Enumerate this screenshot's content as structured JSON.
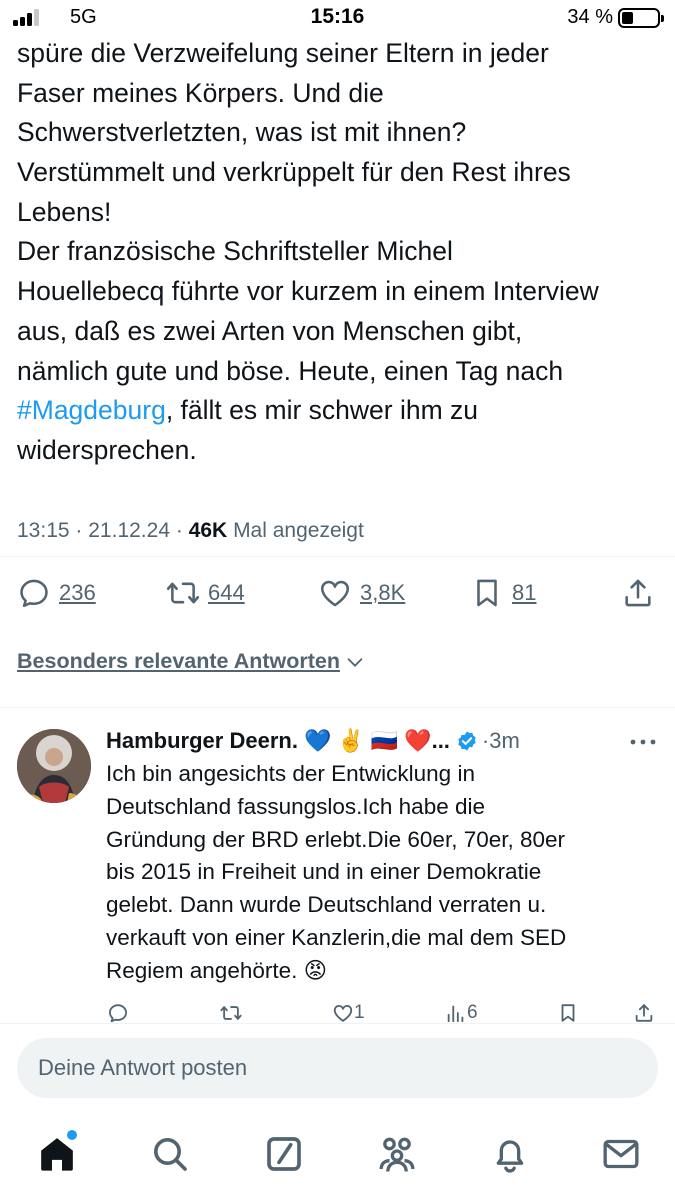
{
  "status_bar": {
    "network": "5G",
    "time": "15:16",
    "battery_percent": "34 %",
    "battery_level": 0.34
  },
  "tweet": {
    "text_lines": [
      "spüre die Verzweifelung seiner Eltern in jeder",
      "Faser meines Körpers. Und die",
      "Schwerstverletzten, was ist mit ihnen?",
      "Verstümmelt und verkrüppelt für den Rest ihres",
      "Lebens!",
      "Der französische Schriftsteller Michel",
      "Houellebecq führte vor kurzem in einem Interview",
      "aus, daß es zwei Arten von Menschen gibt,",
      "nämlich gute und böse. Heute, einen Tag nach"
    ],
    "hashtag": "#Magdeburg",
    "hashtag_line_rest": ", fällt es mir schwer ihm zu",
    "last_line": "widersprechen.",
    "time": "13:15",
    "date": "21.12.24",
    "separator": "·",
    "views": "46K",
    "views_label": "Mal angezeigt",
    "replies": "236",
    "reposts": "644",
    "likes": "3,8K",
    "bookmarks": "81"
  },
  "sort_label": "Besonders relevante Antworten",
  "reply": {
    "name": "Hamburger Deern.",
    "emojis": [
      "💙",
      "✌️",
      "🇷🇺",
      "❤️"
    ],
    "ellipsis": "...",
    "time": "·3m",
    "text_lines": [
      "Ich bin angesichts der Entwicklung in",
      "Deutschland fassungslos.Ich habe die",
      "Gründung der BRD erlebt.Die 60er, 70er, 80er",
      "bis 2015  in Freiheit und in einer Demokratie",
      "gelebt. Dann wurde Deutschland verraten u.",
      "verkauft von einer  Kanzlerin,die mal dem SED"
    ],
    "last_line": "Regiem angehörte. ",
    "last_emoji": "😡",
    "likes": "1",
    "views": "6"
  },
  "composer": {
    "placeholder": "Deine Antwort posten"
  },
  "tabs": [
    "home-icon",
    "search-icon",
    "grok-icon",
    "communities-icon",
    "notifications-icon",
    "messages-icon"
  ],
  "colors": {
    "accent": "#1d9bf0",
    "text": "#0f1419",
    "secondary": "#536471",
    "verified": "#1d9bf0"
  }
}
